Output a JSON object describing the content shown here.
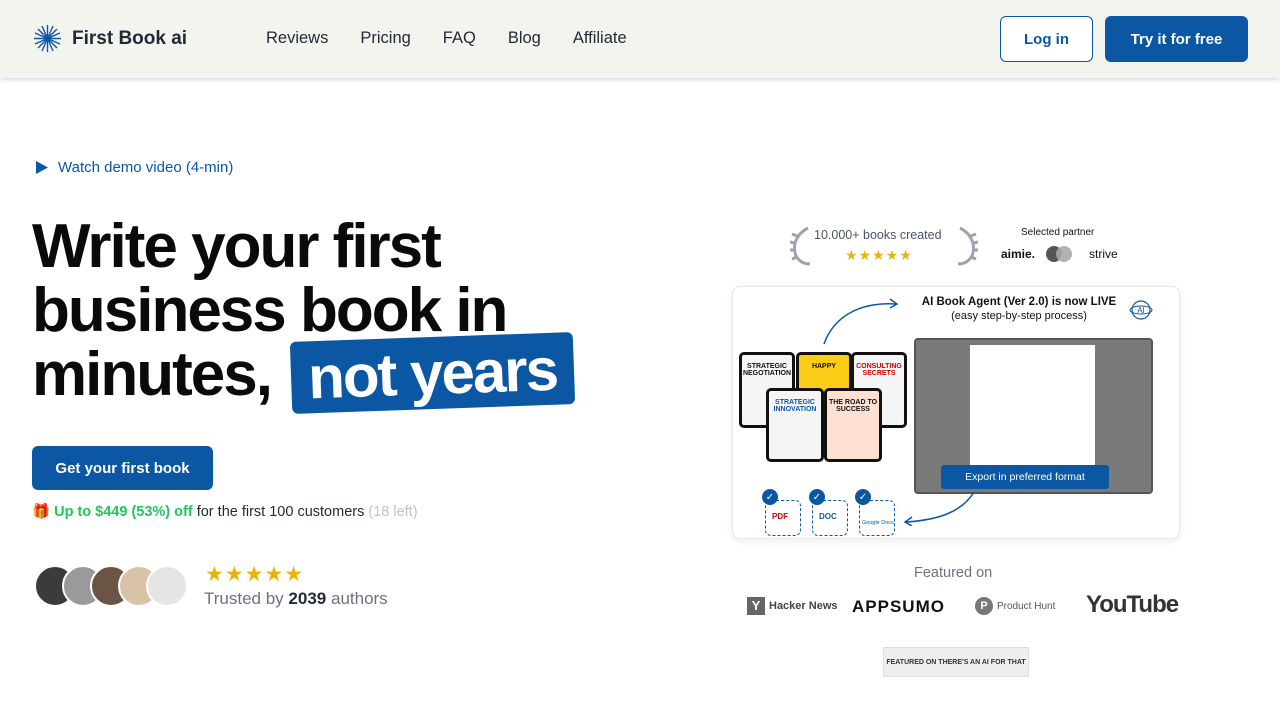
{
  "header": {
    "brand": "First Book ai",
    "nav": [
      "Reviews",
      "Pricing",
      "FAQ",
      "Blog",
      "Affiliate"
    ],
    "login_label": "Log in",
    "try_label": "Try it for free"
  },
  "hero": {
    "watch_label": "Watch demo video (4-min)",
    "headline_line1": "Write your first",
    "headline_line2": "business book in",
    "headline_line3": "minutes,",
    "headline_highlight": "not years",
    "cta_label": "Get your first book",
    "offer_icon": "🎁",
    "offer_highlight": "Up to $449 (53%) off",
    "offer_text": "for the first 100 customers",
    "offer_left": "(18 left)",
    "rating_stars": "★★★★★",
    "trusted_prefix": "Trusted by",
    "trusted_count": "2039",
    "trusted_suffix": "authors"
  },
  "social": {
    "books_created": "10.000+ books created",
    "stars": "★★★★★",
    "partner_label": "Selected partner",
    "partners": [
      "aimie.",
      "strive"
    ]
  },
  "card": {
    "title": "AI Book Agent (Ver 2.0) is now LIVE",
    "subtitle": "(easy step-by-step process)",
    "export_label": "Export in preferred format",
    "books": [
      "STRATEGIC NEGOTIATION",
      "HAPPY",
      "CONSULTING SECRETS",
      "STRATEGIC INNOVATION",
      "THE ROAD TO SUCCESS"
    ],
    "files": [
      "PDF",
      "DOC",
      "Google Docs"
    ]
  },
  "featured": {
    "label": "Featured on",
    "logos": [
      "Hacker News",
      "APPSUMO",
      "Product Hunt",
      "YouTube"
    ],
    "aift_label": "FEATURED ON THERE'S AN AI FOR THAT"
  }
}
